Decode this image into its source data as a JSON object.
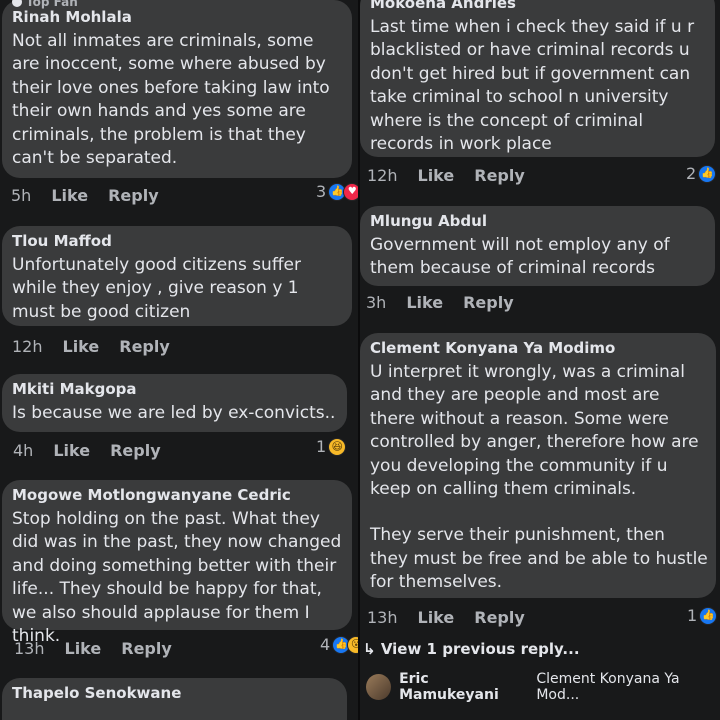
{
  "left": {
    "top_fan_label": "Top Fan",
    "comments": [
      {
        "author": "Rinah Mohlala",
        "text": "Not all inmates are criminals, some are inoccent, some where abused by their love ones before taking law into their own hands and yes some are criminals, the problem is that they can't be separated.",
        "time": "5h",
        "like": "Like",
        "reply": "Reply",
        "reaction_count": "3"
      },
      {
        "author": "Tlou Maffod",
        "text": "Unfortunately good citizens suffer while they enjoy , give reason y 1 must be good citizen",
        "time": "12h",
        "like": "Like",
        "reply": "Reply"
      },
      {
        "author": "Mkiti Makgopa",
        "text": "Is because we are led by ex-convicts..",
        "time": "4h",
        "like": "Like",
        "reply": "Reply",
        "reaction_count": "1"
      },
      {
        "author": "Mogowe Motlongwanyane Cedric",
        "text": "Stop holding on the past. What they did was in the past, they now changed and doing something better with their life... They should be happy for that, we also should applause for them I think.",
        "time": "13h",
        "like": "Like",
        "reply": "Reply",
        "reaction_count": "4"
      },
      {
        "author": "Thapelo Senokwane"
      }
    ]
  },
  "right": {
    "comments": [
      {
        "author": "Mokoena Andries",
        "text": "Last time when i check they said if u r blacklisted or have criminal records u don't get hired but if government can take criminal to school n university where is the concept of criminal records in work place",
        "time": "12h",
        "like": "Like",
        "reply": "Reply",
        "reaction_count": "2"
      },
      {
        "author": "Mlungu Abdul",
        "text": "Government will not employ any of them because of criminal records",
        "time": "3h",
        "like": "Like",
        "reply": "Reply"
      },
      {
        "author": "Clement Konyana Ya Modimo",
        "text_p1": "U interpret it wrongly, was a criminal and they are people and most are there without a reason. Some were controlled by anger, therefore how are you developing the community if u keep on calling them criminals.",
        "text_p2": "They serve their punishment, then they must be free and be able to hustle for themselves.",
        "time": "13h",
        "like": "Like",
        "reply": "Reply",
        "reaction_count": "1"
      }
    ],
    "view_previous": "View 1 previous reply...",
    "reply_preview": {
      "name": "Eric Mamukeyani",
      "snippet": "Clement Konyana Ya Mod..."
    }
  },
  "colors": {
    "background": "#18191a",
    "bubble": "#3a3b3c",
    "like_blue": "#1877f2",
    "love_red": "#f02849",
    "haha_yellow": "#f7b928"
  }
}
